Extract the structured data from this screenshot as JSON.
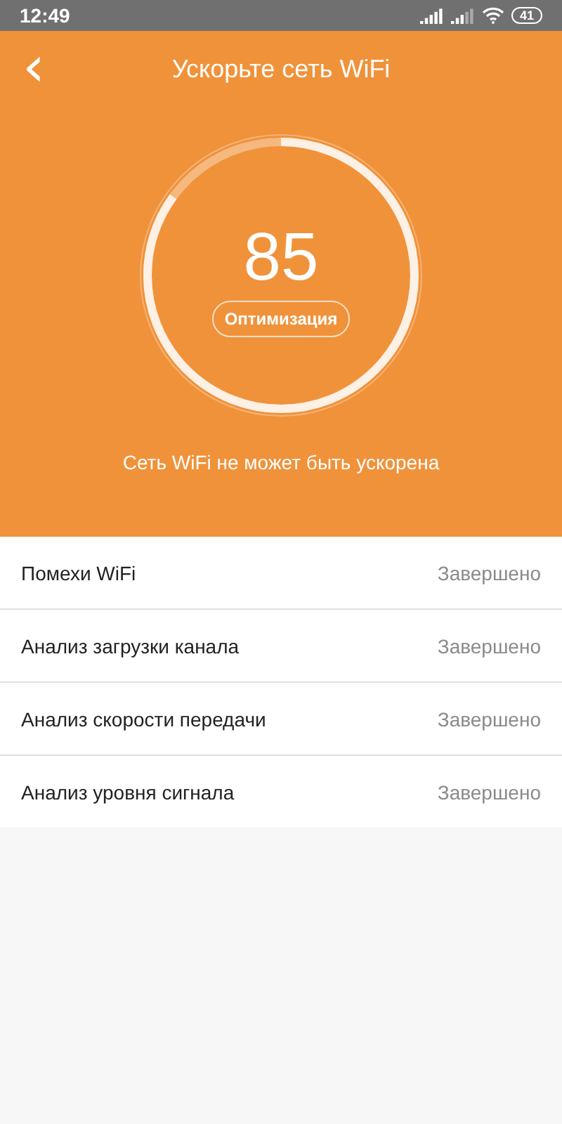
{
  "status_bar": {
    "time": "12:49",
    "battery": "41"
  },
  "header": {
    "back": "‹",
    "title": "Ускорьте сеть WiFi"
  },
  "gauge": {
    "level": 0.85,
    "score": "85",
    "button": "Оптимизация"
  },
  "message": "Сеть WiFi не может быть ускорена",
  "checks": [
    {
      "label": "Помехи WiFi",
      "status": "Завершено"
    },
    {
      "label": "Анализ загрузки канала",
      "status": "Завершено"
    },
    {
      "label": "Анализ скорости передачи",
      "status": "Завершено"
    },
    {
      "label": "Анализ уровня сигнала",
      "status": "Завершено"
    }
  ]
}
